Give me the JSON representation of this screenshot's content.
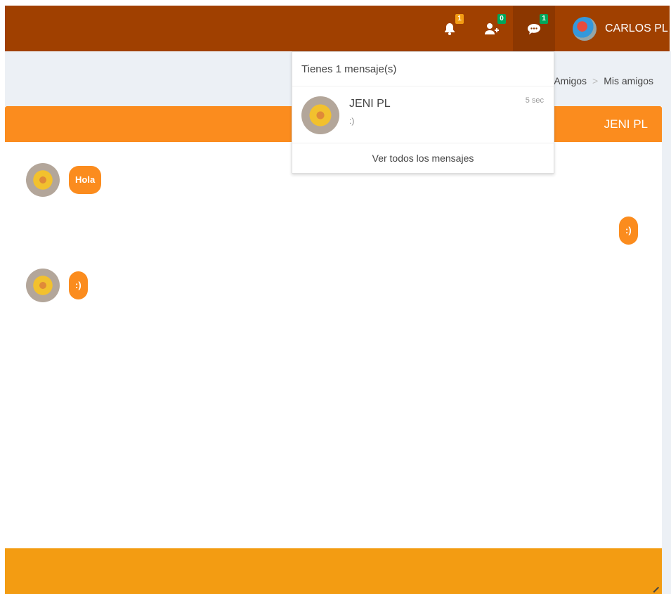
{
  "navbar": {
    "notifications": {
      "icon": "bell-icon",
      "count": "1"
    },
    "friend_requests": {
      "icon": "user-plus-icon",
      "count": "0"
    },
    "messages": {
      "icon": "chat-icon",
      "count": "1"
    },
    "user": {
      "name": "CARLOS PL"
    }
  },
  "breadcrumb": {
    "items": [
      "Amigos",
      "Mis amigos"
    ],
    "separator": ">"
  },
  "chat": {
    "title": "JENI PL",
    "messages": [
      {
        "side": "left",
        "text": "Hola"
      },
      {
        "side": "right",
        "text": ":)"
      },
      {
        "side": "left",
        "text": ":)"
      }
    ]
  },
  "dropdown": {
    "header": "Tienes 1 mensaje(s)",
    "items": [
      {
        "name": "JENI PL",
        "text": ":)",
        "time": "5 sec"
      }
    ],
    "footer": "Ver todos los mensajes"
  },
  "colors": {
    "navbar": "#a04000",
    "chat_header": "#fb8c1e",
    "chat_footer": "#f39c12",
    "badge_yellow": "#f39c12",
    "badge_green": "#00a65a"
  }
}
